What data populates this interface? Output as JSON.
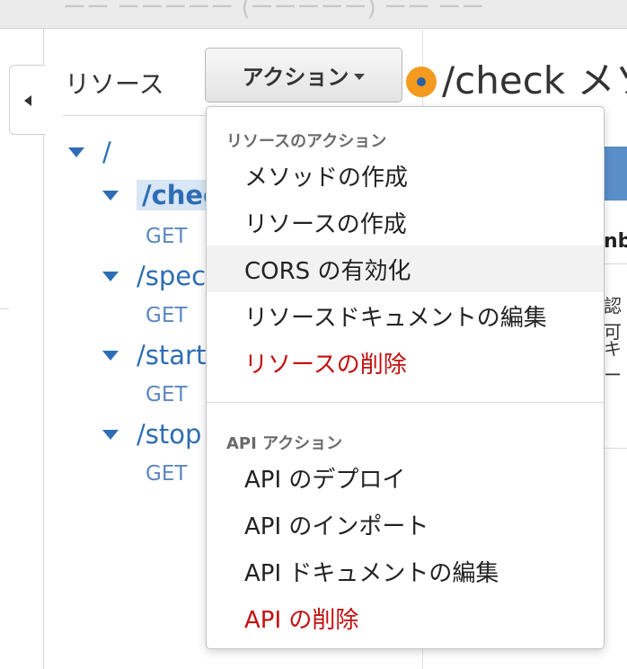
{
  "window_title": "ーー ーーーーー (ーーーーー) ーー ーー",
  "resources_heading": "リソース",
  "actions_button": {
    "label": "アクション"
  },
  "method_title": "/check メソ",
  "tree": [
    {
      "path": "/"
    },
    {
      "path": "/chec",
      "selected": true,
      "method": "GET"
    },
    {
      "path": "/speco",
      "method": "GET"
    },
    {
      "path": "/start",
      "method": "GET"
    },
    {
      "path": "/stop",
      "method": "GET"
    }
  ],
  "right_panel": {
    "text_1": "nbe",
    "text_2": "認可",
    "text_3": "キー"
  },
  "menu": {
    "resource_section_title": "リソースのアクション",
    "resource_items": [
      {
        "label": "メソッドの作成"
      },
      {
        "label": "リソースの作成"
      },
      {
        "label": "CORS の有効化",
        "hovered": true
      },
      {
        "label": "リソースドキュメントの編集"
      },
      {
        "label": "リソースの削除",
        "danger": true
      }
    ],
    "api_section_title": "API アクション",
    "api_items": [
      {
        "label": "API のデプロイ"
      },
      {
        "label": "API のインポート"
      },
      {
        "label": "API ドキュメントの編集"
      },
      {
        "label": "API の削除",
        "danger": true
      }
    ]
  },
  "colors": {
    "link_blue": "#2e6db4",
    "danger_red": "#c40f0f",
    "badge_orange": "#f49a1f"
  },
  "icons": {
    "collapse_panel": "triangle-left-icon",
    "tree_expand": "triangle-down-icon",
    "dropdown_caret": "caret-down-icon",
    "status_badge": "dot-badge-icon"
  }
}
